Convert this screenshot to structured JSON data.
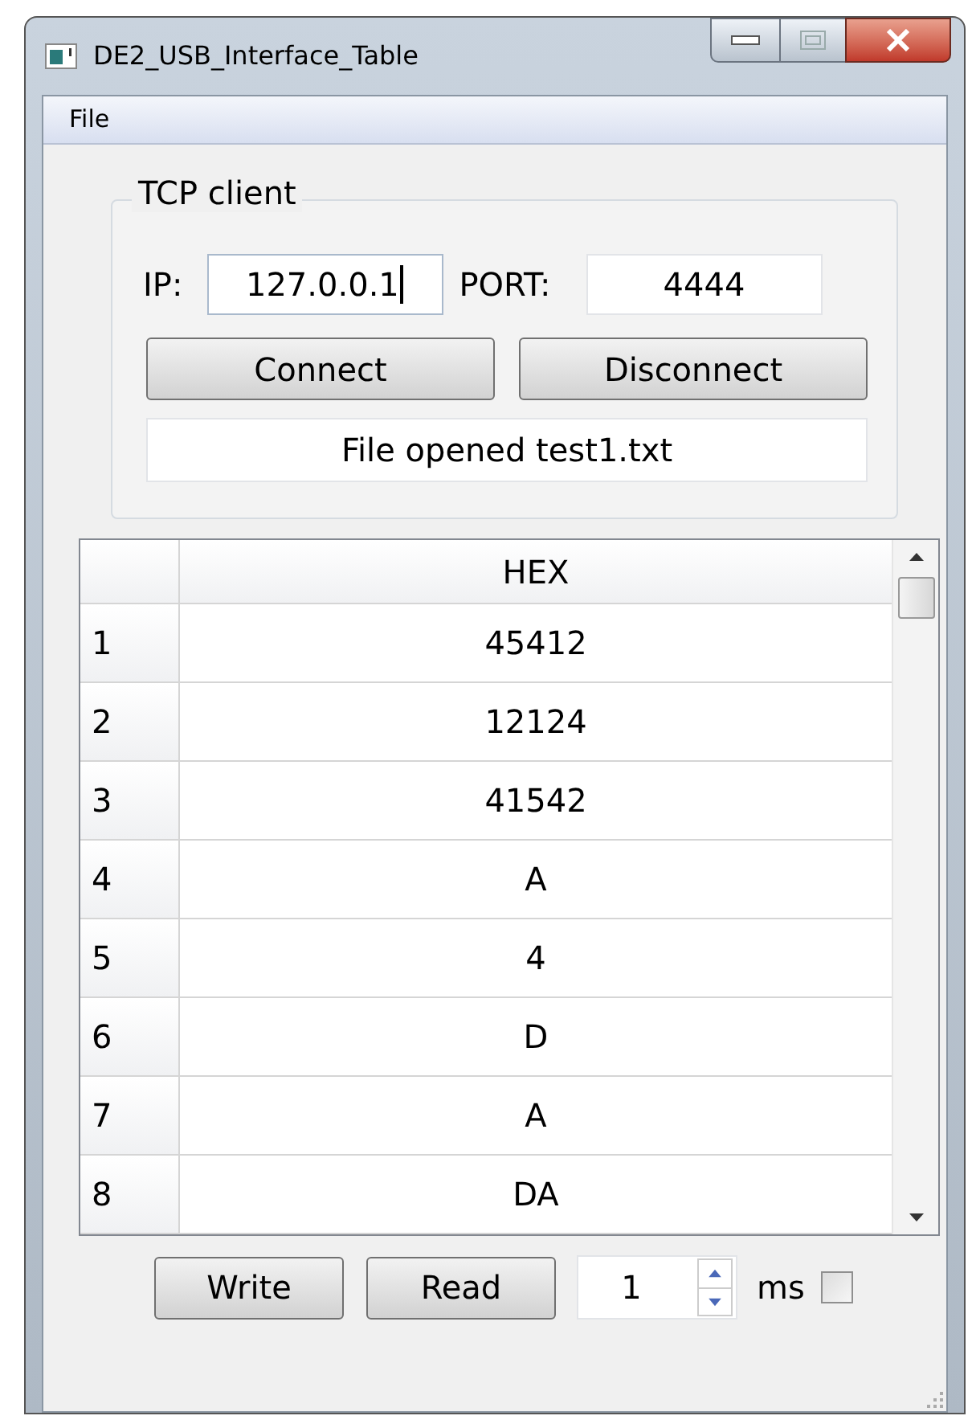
{
  "window": {
    "title": "DE2_USB_Interface_Table"
  },
  "menu": [
    "File"
  ],
  "tcp_client": {
    "title": "TCP client",
    "ip_label": "IP:",
    "ip": "127.0.0.1",
    "port_label": "PORT:",
    "port": "4444",
    "buttons": [
      "Connect",
      "Disconnect"
    ],
    "status": "File opened test1.txt"
  },
  "table": {
    "columns": [
      "HEX"
    ],
    "rows": [
      {
        "header": "1",
        "value": "45412"
      },
      {
        "header": "2",
        "value": "12124"
      },
      {
        "header": "3",
        "value": "41542"
      },
      {
        "header": "4",
        "value": "A"
      },
      {
        "header": "5",
        "value": "4"
      },
      {
        "header": "6",
        "value": "D"
      },
      {
        "header": "7",
        "value": "A"
      },
      {
        "header": "8",
        "value": "DA"
      }
    ]
  },
  "controls": {
    "buttons": [
      "Write",
      "Read"
    ],
    "interval": "1",
    "unit": "ms",
    "checked": false
  }
}
